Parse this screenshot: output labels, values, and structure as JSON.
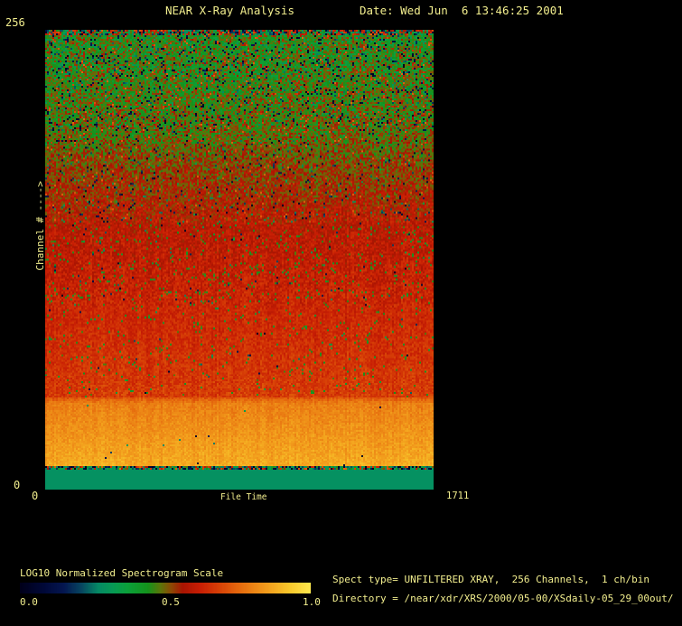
{
  "window": {
    "bg": "#000000",
    "text_color": "#f2ee8e"
  },
  "header": {
    "title": "NEAR X-Ray Analysis",
    "date": "Date: Wed Jun  6 13:46:25 2001"
  },
  "plot": {
    "y_axis": {
      "max_label": "256",
      "min_label": "0",
      "title": "Channel # ---->"
    },
    "x_axis": {
      "min_label": "0",
      "title": "File Time",
      "max_label": "1711"
    }
  },
  "scale": {
    "title": "LOG10 Normalized Spectrogram Scale",
    "ticks": [
      "0.0",
      "0.5",
      "1.0"
    ]
  },
  "info": {
    "spect_type": "Spect type= UNFILTERED XRAY,  256 Channels,  1 ch/bin",
    "directory": "Directory = /near/xdr/XRS/2000/05-00/XSdaily-05_29_00out/"
  },
  "chart_data": {
    "type": "heatmap",
    "title": "NEAR X-Ray Analysis",
    "xlabel": "File Time",
    "ylabel": "Channel #",
    "x_range": [
      0,
      1711
    ],
    "y_range": [
      0,
      256
    ],
    "legend_position": "bottom-left",
    "colorbar": {
      "label": "LOG10 Normalized Spectrogram Scale",
      "ticks": [
        0.0,
        0.5,
        1.0
      ],
      "range": [
        0,
        1
      ]
    },
    "palette_stops": [
      [
        0.0,
        "#00001a"
      ],
      [
        0.08,
        "#000838"
      ],
      [
        0.15,
        "#041650"
      ],
      [
        0.21,
        "#074560"
      ],
      [
        0.27,
        "#058a64"
      ],
      [
        0.32,
        "#079a55"
      ],
      [
        0.37,
        "#0ba03a"
      ],
      [
        0.44,
        "#14931c"
      ],
      [
        0.48,
        "#57790a"
      ],
      [
        0.52,
        "#8c4a04"
      ],
      [
        0.56,
        "#a81402"
      ],
      [
        0.62,
        "#c81e04"
      ],
      [
        0.68,
        "#d63d06"
      ],
      [
        0.76,
        "#e66d0e"
      ],
      [
        0.85,
        "#f29d1c"
      ],
      [
        0.93,
        "#f9c92c"
      ],
      [
        1.0,
        "#ffe84e"
      ]
    ],
    "profile_bands": [
      {
        "f0": 0.0,
        "f1": 0.008,
        "v0": 0.43,
        "v1": 0.43,
        "noise": 0.5,
        "dark_prob": 0.25,
        "warm_prob": 0.15
      },
      {
        "f0": 0.008,
        "f1": 0.1,
        "v0": 0.44,
        "v1": 0.455,
        "noise": 0.18,
        "dark_prob": 0.14,
        "warm_prob": 0.05
      },
      {
        "f0": 0.1,
        "f1": 0.22,
        "v0": 0.455,
        "v1": 0.48,
        "noise": 0.16,
        "dark_prob": 0.1,
        "warm_prob": 0.07
      },
      {
        "f0": 0.22,
        "f1": 0.42,
        "v0": 0.48,
        "v1": 0.585,
        "noise": 0.14,
        "dark_prob": 0.05,
        "warm_prob": 0.04
      },
      {
        "f0": 0.42,
        "f1": 0.6,
        "v0": 0.585,
        "v1": 0.63,
        "noise": 0.1,
        "dark_prob": 0.01,
        "green_prob": 0.05
      },
      {
        "f0": 0.6,
        "f1": 0.802,
        "v0": 0.63,
        "v1": 0.675,
        "noise": 0.08,
        "dark_prob": 0.004,
        "green_prob": 0.03
      },
      {
        "f0": 0.802,
        "f1": 0.812,
        "v0": 0.72,
        "v1": 0.78,
        "noise": 0.06
      },
      {
        "f0": 0.812,
        "f1": 0.952,
        "v0": 0.79,
        "v1": 0.875,
        "noise": 0.06,
        "dark_prob": 0.002
      },
      {
        "f0": 0.952,
        "f1": 0.957,
        "v0": 0.5,
        "v1": 0.5,
        "noise": 0.5,
        "dark_prob": 0.5
      },
      {
        "f0": 0.957,
        "f1": 1.0,
        "flat": "#059161"
      }
    ]
  }
}
